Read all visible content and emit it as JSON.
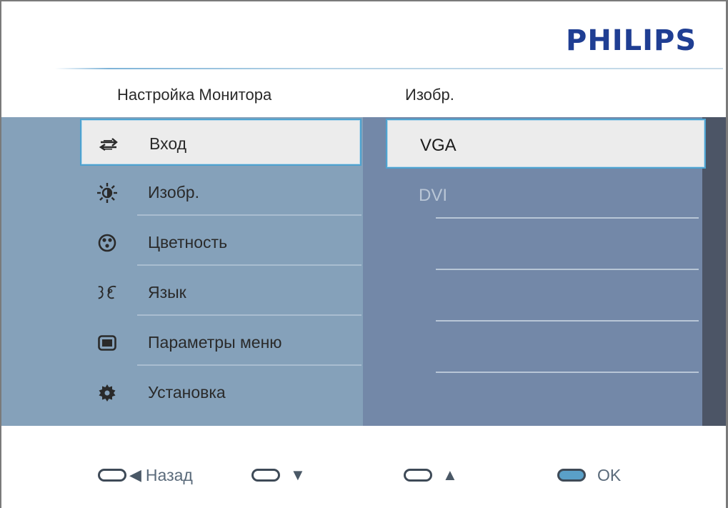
{
  "brand": {
    "logo_text": "PHILIPS",
    "color": "#1f3e93"
  },
  "header": {
    "left_title": "Настройка Монитора",
    "right_title": "Изобр."
  },
  "menu": {
    "items": [
      {
        "label": "Вход",
        "icon": "input-arrows-icon",
        "selected": true
      },
      {
        "label": "Изобр.",
        "icon": "sun-brightness-icon",
        "selected": false
      },
      {
        "label": "Цветность",
        "icon": "color-palette-icon",
        "selected": false
      },
      {
        "label": "Язык",
        "icon": "language-speech-icon",
        "selected": false
      },
      {
        "label": "Параметры меню",
        "icon": "osd-menu-icon",
        "selected": false
      },
      {
        "label": "Установка",
        "icon": "gear-icon",
        "selected": false
      }
    ]
  },
  "submenu": {
    "items": [
      {
        "label": "VGA",
        "selected": true
      },
      {
        "label": "DVI",
        "selected": false
      }
    ]
  },
  "footer": {
    "back_label": "Назад",
    "down_symbol": "▼",
    "up_symbol": "▲",
    "ok_label": "OK",
    "back_symbol": "◀"
  },
  "colors": {
    "accent": "#4ea2cf",
    "band": "#85a1ba",
    "submenu_bg": "#7388a8"
  }
}
